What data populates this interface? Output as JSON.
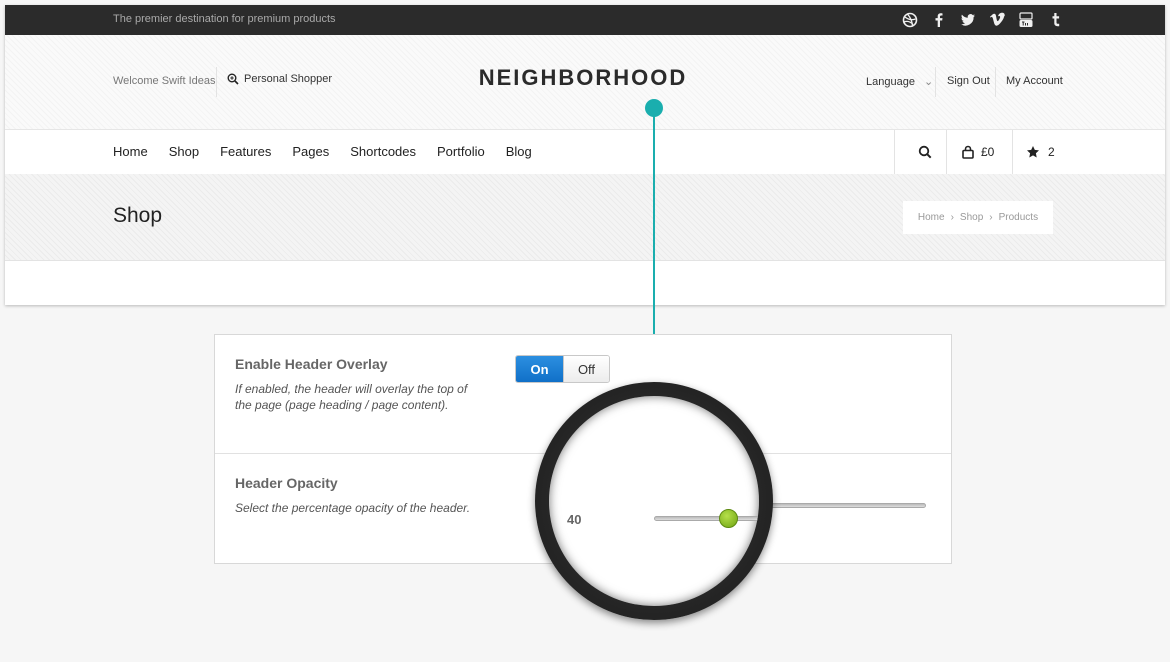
{
  "topbar": {
    "tagline": "The premier destination for premium products",
    "social_icons": [
      "dribbble-icon",
      "facebook-icon",
      "twitter-icon",
      "vimeo-icon",
      "youtube-icon",
      "tumblr-icon"
    ]
  },
  "header": {
    "welcome": "Welcome Swift Ideas",
    "personal_shopper": "Personal Shopper",
    "logo": "NEIGHBORHOOD",
    "language": "Language",
    "sign_out": "Sign Out",
    "my_account": "My Account"
  },
  "nav": {
    "items": [
      "Home",
      "Shop",
      "Features",
      "Pages",
      "Shortcodes",
      "Portfolio",
      "Blog"
    ],
    "cart_total": "£0",
    "wishlist_count": "2"
  },
  "page": {
    "title": "Shop",
    "breadcrumb": [
      "Home",
      "Shop",
      "Products"
    ]
  },
  "options": {
    "overlay": {
      "title": "Enable Header Overlay",
      "description": "If enabled, the header will overlay the top of the page (page heading / page content).",
      "on_label": "On",
      "off_label": "Off",
      "state": "On"
    },
    "opacity": {
      "title": "Header Opacity",
      "description": "Select the percentage opacity of the header.",
      "value": "40"
    }
  },
  "colors": {
    "topbar": "#2b2b2b",
    "accent": "#1aaeae",
    "toggle_on": "#1a7fd6",
    "slider_handle": "#8cc021"
  }
}
